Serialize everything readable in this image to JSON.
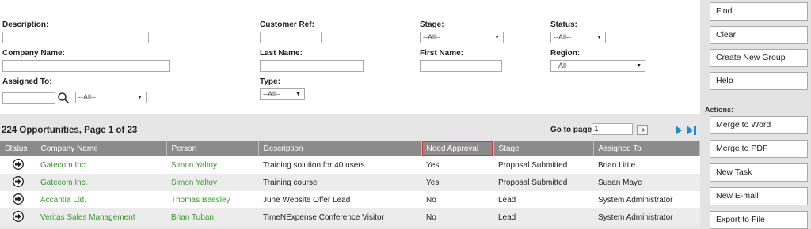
{
  "filters": {
    "description_label": "Description:",
    "customer_ref_label": "Customer Ref:",
    "stage_label": "Stage:",
    "stage_value": "--All--",
    "status_label": "Status:",
    "status_value": "--All--",
    "company_name_label": "Company Name:",
    "last_name_label": "Last Name:",
    "first_name_label": "First Name:",
    "region_label": "Region:",
    "region_value": "--All--",
    "assigned_to_label": "Assigned To:",
    "assigned_to_value": "--All--",
    "type_label": "Type:",
    "type_value": "--All--"
  },
  "results": {
    "title": "224 Opportunities, Page 1 of 23",
    "goto_label": "Go to page",
    "goto_value": "1"
  },
  "table": {
    "columns": [
      "Status",
      "Company Name",
      "Person",
      "Description",
      "Need Approval",
      "Stage",
      "Assigned To"
    ],
    "rows": [
      {
        "company": "Gatecom Inc.",
        "person": "Simon Yaltoy",
        "description": "Training solution for 40 users",
        "approval": "Yes",
        "stage": "Proposal Submitted",
        "assigned": "Brian Little"
      },
      {
        "company": "Gatecom Inc.",
        "person": "Simon Yaltoy",
        "description": "Training course",
        "approval": "Yes",
        "stage": "Proposal Submitted",
        "assigned": "Susan Maye"
      },
      {
        "company": "Accantia Ltd.",
        "person": "Thomas Beesley",
        "description": "June Website Offer Lead",
        "approval": "No",
        "stage": "Lead",
        "assigned": "System Administrator"
      },
      {
        "company": "Veritas Sales Management",
        "person": "Brian Tuban",
        "description": "TimeNExpense Conference Visitor",
        "approval": "No",
        "stage": "Lead",
        "assigned": "System Administrator"
      }
    ]
  },
  "sidebar": {
    "find": "Find",
    "clear": "Clear",
    "create_group": "Create New Group",
    "help": "Help",
    "actions_label": "Actions:",
    "merge_word": "Merge to Word",
    "merge_pdf": "Merge to PDF",
    "new_task": "New Task",
    "new_email": "New E-mail",
    "export_file": "Export to File"
  },
  "colors": {
    "link": "#3a9a2f",
    "header_bg": "#8b8b8b",
    "highlight": "#d23a3a",
    "pager_arrow": "#1e88d0"
  }
}
